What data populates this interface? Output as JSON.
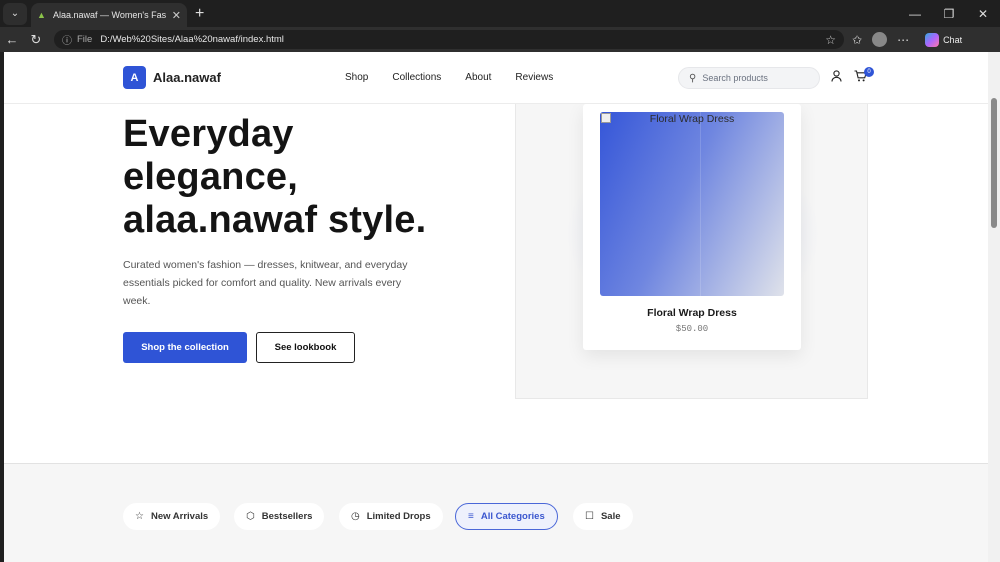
{
  "browser": {
    "tab_title": "Alaa.nawaf — Women's Fashion St",
    "url_scheme": "File",
    "url_path": "D:/Web%20Sites/Alaa%20nawaf/index.html",
    "chat_label": "Chat"
  },
  "header": {
    "brand_initial": "A",
    "brand_name": "Alaa.nawaf",
    "nav": [
      "Shop",
      "Collections",
      "About",
      "Reviews"
    ],
    "search_placeholder": "Search products",
    "cart_count": "0"
  },
  "hero": {
    "title_lines": [
      "Everyday",
      "elegance,",
      "alaa.nawaf style."
    ],
    "subtitle": "Curated women's fashion — dresses, knitwear, and everyday essentials picked for comfort and quality. New arrivals every week.",
    "primary_cta": "Shop the collection",
    "secondary_cta": "See lookbook"
  },
  "featured_product": {
    "image_alt": "Floral Wrap Dress",
    "name": "Floral Wrap Dress",
    "price": "$50.00"
  },
  "categories": [
    {
      "label": "New Arrivals",
      "icon": "star-icon",
      "active": false
    },
    {
      "label": "Bestsellers",
      "icon": "hexagon-icon",
      "active": false
    },
    {
      "label": "Limited Drops",
      "icon": "clock-icon",
      "active": false
    },
    {
      "label": "All Categories",
      "icon": "list-icon",
      "active": true
    },
    {
      "label": "Sale",
      "icon": "square-icon",
      "active": false
    }
  ],
  "colors": {
    "accent": "#2f54d6",
    "text": "#141414",
    "band_bg": "#f6f6f6"
  }
}
